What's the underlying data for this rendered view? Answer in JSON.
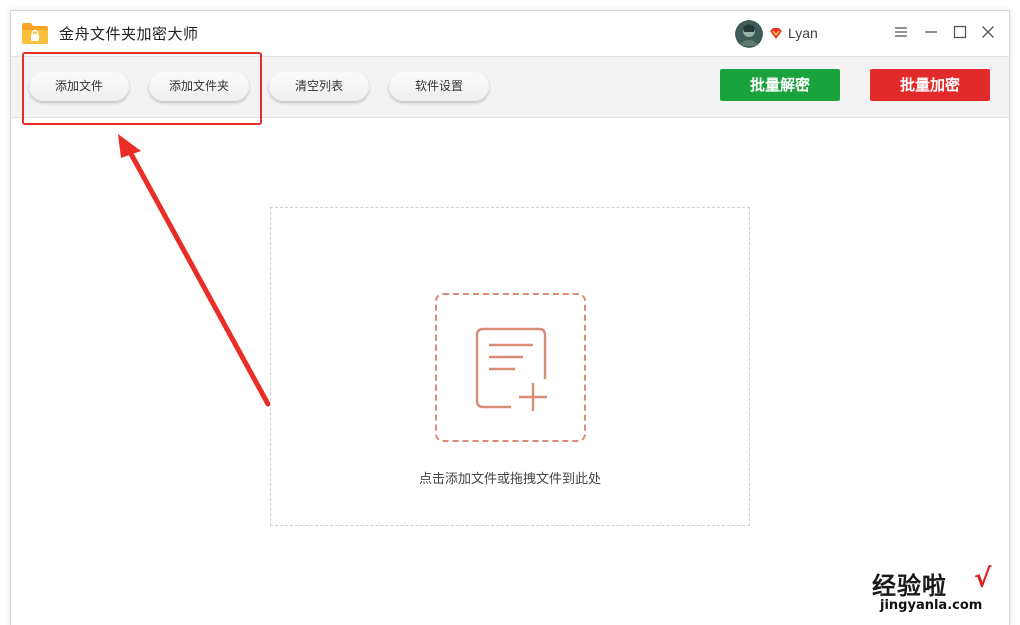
{
  "app": {
    "title": "金舟文件夹加密大师"
  },
  "user": {
    "name": "Lyan"
  },
  "toolbar": {
    "add_file": "添加文件",
    "add_folder": "添加文件夹",
    "clear_list": "清空列表",
    "settings": "软件设置",
    "batch_decrypt": "批量解密",
    "batch_encrypt": "批量加密"
  },
  "dropzone": {
    "hint": "点击添加文件或拖拽文件到此处"
  },
  "watermark": {
    "main": "经验啦",
    "check": "√",
    "sub": "jingyanla.com"
  },
  "colors": {
    "decrypt_button": "#1aa23c",
    "encrypt_button": "#e32a2a",
    "annotation": "#ea2e25",
    "drop_icon": "#d98c78"
  }
}
